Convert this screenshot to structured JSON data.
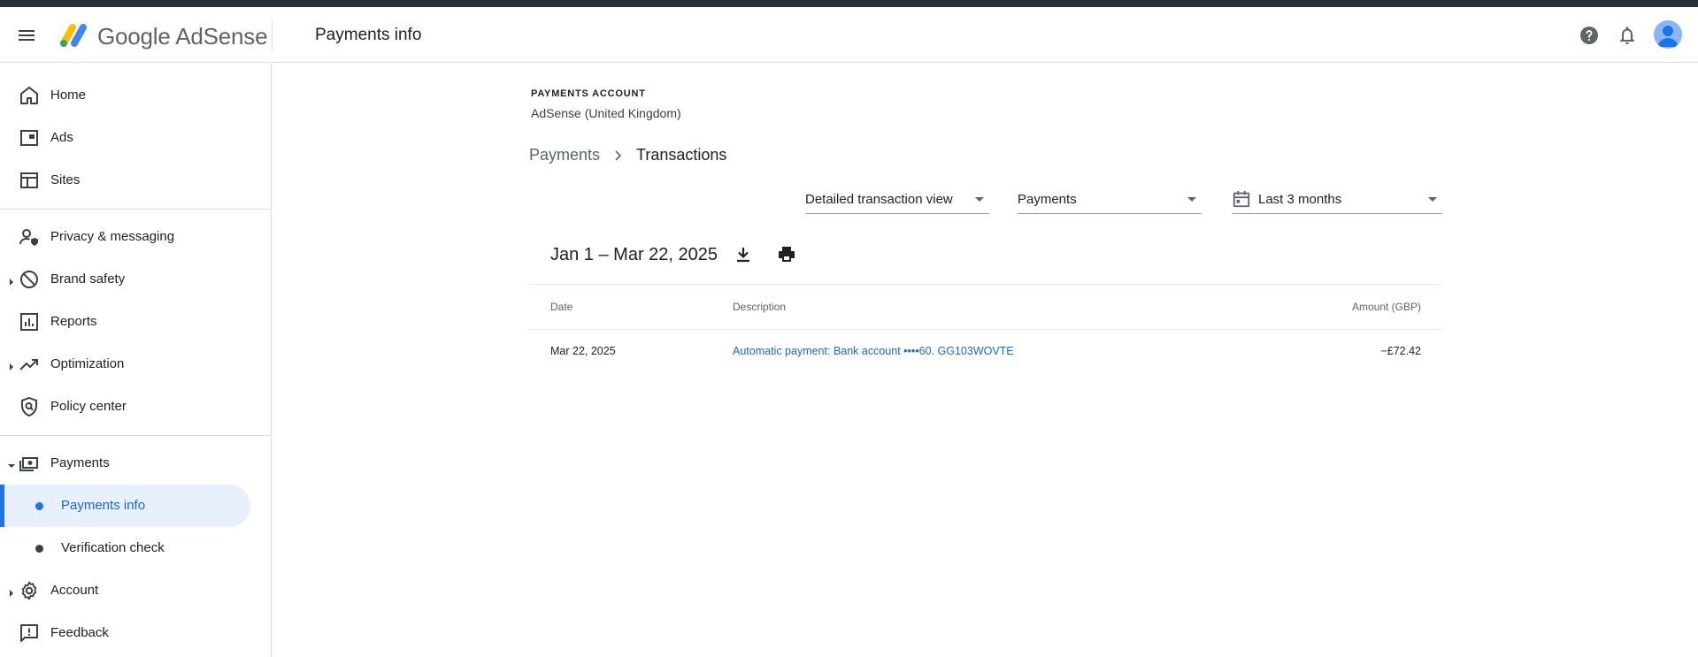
{
  "header": {
    "brand": "Google AdSense",
    "page_title": "Payments info"
  },
  "sidebar": {
    "items": [
      {
        "label": "Home",
        "icon": "home-icon"
      },
      {
        "label": "Ads",
        "icon": "ads-icon"
      },
      {
        "label": "Sites",
        "icon": "sites-icon"
      },
      {
        "label": "Privacy & messaging",
        "icon": "privacy-icon"
      },
      {
        "label": "Brand safety",
        "icon": "block-icon"
      },
      {
        "label": "Reports",
        "icon": "reports-icon"
      },
      {
        "label": "Optimization",
        "icon": "trending-icon"
      },
      {
        "label": "Policy center",
        "icon": "shield-icon"
      },
      {
        "label": "Payments",
        "icon": "payments-icon"
      },
      {
        "label": "Account",
        "icon": "gear-icon"
      },
      {
        "label": "Feedback",
        "icon": "feedback-icon"
      }
    ],
    "subitems": [
      {
        "label": "Payments info",
        "active": true
      },
      {
        "label": "Verification check",
        "active": false
      }
    ]
  },
  "main": {
    "account_label": "PAYMENTS ACCOUNT",
    "account_name": "AdSense (United Kingdom)",
    "breadcrumb": {
      "parent": "Payments",
      "current": "Transactions"
    },
    "filters": {
      "view": "Detailed transaction view",
      "type": "Payments",
      "range": "Last 3 months"
    },
    "range_title": "Jan 1 – Mar 22, 2025",
    "table": {
      "headers": {
        "date": "Date",
        "description": "Description",
        "amount": "Amount (GBP)"
      },
      "rows": [
        {
          "date": "Mar 22, 2025",
          "description": "Automatic payment: Bank account ••••60. GG103WOVTE",
          "amount": "−£72.42"
        }
      ]
    }
  },
  "colors": {
    "accent": "#1a73e8",
    "active_bg": "#e8f0fe",
    "link": "#1967d2"
  }
}
